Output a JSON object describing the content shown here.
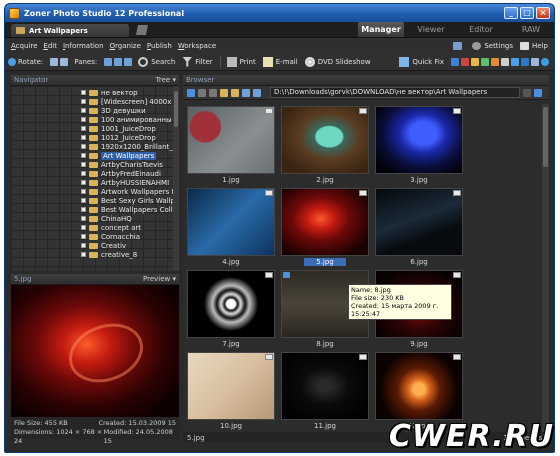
{
  "window": {
    "title": "Zoner Photo Studio 12 Professional"
  },
  "doc_tab": {
    "label": "Art Wallpapers"
  },
  "mode_tabs": [
    {
      "label": "Manager",
      "active": true
    },
    {
      "label": "Viewer",
      "active": false
    },
    {
      "label": "Editor",
      "active": false
    },
    {
      "label": "RAW",
      "active": false
    }
  ],
  "menu": [
    "Acquire",
    "Edit",
    "Information",
    "Organize",
    "Publish",
    "Workspace"
  ],
  "menu_right": {
    "settings": "Settings",
    "help": "Help"
  },
  "toolbar": {
    "rotate": "Rotate:",
    "panes": "Panes:",
    "search": "Search",
    "filter": "Filter",
    "print": "Print",
    "email": "E-mail",
    "dvd": "DVD Slideshow",
    "quickfix": "Quick Fix"
  },
  "navigator": {
    "title": "Navigator",
    "mode": "Tree",
    "items": [
      {
        "label": "не вектор",
        "selected": false
      },
      {
        "label": "[Widescreen] 4000x",
        "selected": false
      },
      {
        "label": "3D девушки",
        "selected": false
      },
      {
        "label": "100 анимированны",
        "selected": false
      },
      {
        "label": "1001_JuiceDrop",
        "selected": false
      },
      {
        "label": "1012_JuiceDrop",
        "selected": false
      },
      {
        "label": "1920x1200_Brillant_",
        "selected": false
      },
      {
        "label": "Art Wallpapers",
        "selected": true
      },
      {
        "label": "ArtbyCharisTsevis",
        "selected": false
      },
      {
        "label": "ArtbyFredEinaudi",
        "selected": false
      },
      {
        "label": "ArtbyHUSSIENAHMI",
        "selected": false
      },
      {
        "label": "Artwork Wallpapers I",
        "selected": false
      },
      {
        "label": "Best Sexy Girls Wallp",
        "selected": false
      },
      {
        "label": "Best Wallpapers Colle",
        "selected": false
      },
      {
        "label": "ChinaHQ",
        "selected": false
      },
      {
        "label": "concept art",
        "selected": false
      },
      {
        "label": "Cornacchia",
        "selected": false
      },
      {
        "label": "Creativ",
        "selected": false
      },
      {
        "label": "creative_8",
        "selected": false
      }
    ]
  },
  "preview": {
    "filename": "5.jpg",
    "mode": "Preview",
    "file_size": "File Size: 455 KB",
    "created": "Created: 15.03.2009 15",
    "dimensions": "Dimensions: 1024 × 768 × 24",
    "modified": "Modified: 24.05.2008 15"
  },
  "browser": {
    "title": "Browser",
    "path": "D:\\!\\Downloads\\gorvk\\DOWNLOAD\\не вектор\\Art Wallpapers",
    "thumbs": [
      {
        "name": "1.jpg"
      },
      {
        "name": "2.jpg"
      },
      {
        "name": "3.jpg"
      },
      {
        "name": "4.jpg"
      },
      {
        "name": "5.jpg"
      },
      {
        "name": "6.jpg"
      },
      {
        "name": "7.jpg"
      },
      {
        "name": "8.jpg"
      },
      {
        "name": "9.jpg"
      },
      {
        "name": "10.jpg"
      },
      {
        "name": "11.jpg"
      },
      {
        "name": "12.jpg"
      }
    ],
    "tooltip": {
      "name": "Name: 8.jpg",
      "size": "File size: 230 KB",
      "created": "Created: 15 марта 2009 г. 15:25:47"
    },
    "status_left": "5.jpg",
    "status_right": "15 object(s)"
  },
  "watermark": "CWER.RU"
}
